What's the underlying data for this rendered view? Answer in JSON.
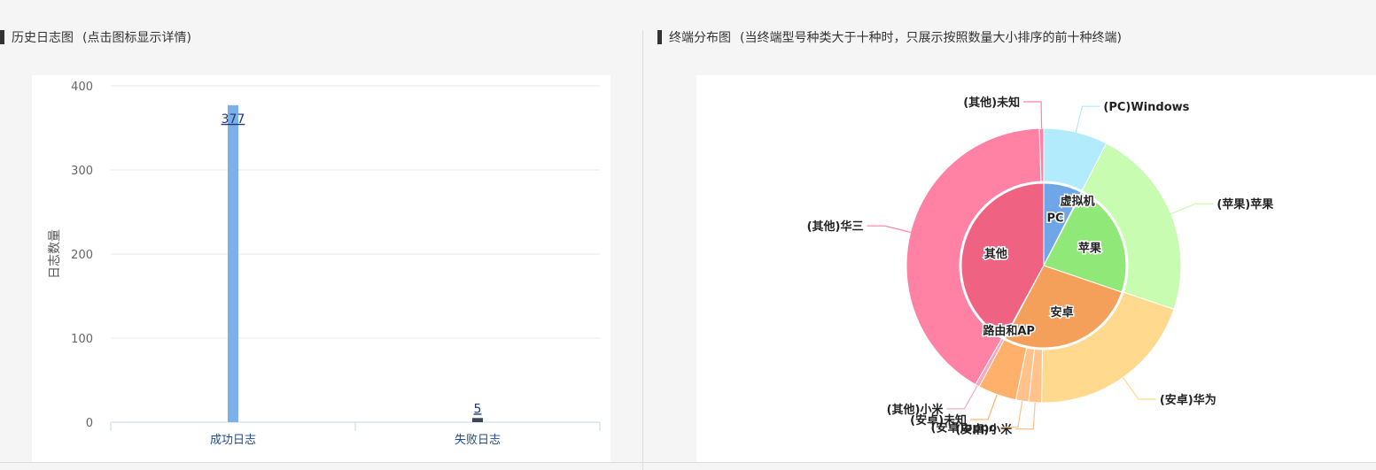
{
  "left_panel": {
    "title": "历史日志图",
    "subtitle": "(点击图标显示详情)"
  },
  "right_panel": {
    "title": "终端分布图",
    "subtitle": "(当终端型号种类大于十种时，只展示按照数量大小排序的前十种终端)"
  },
  "chart_data": [
    {
      "type": "bar",
      "ylabel": "日志数量",
      "categories": [
        "成功日志",
        "失败日志"
      ],
      "values": [
        377,
        5
      ],
      "ylim": [
        0,
        400
      ],
      "yticks": [
        0,
        100,
        200,
        300,
        400
      ],
      "colors": [
        "#7cb0ea",
        "#3d4654"
      ],
      "grid": true
    },
    {
      "type": "pie",
      "inner": {
        "labels": [
          "PC",
          "虚拟机",
          "苹果",
          "安卓",
          "路由和AP",
          "其他"
        ],
        "values": [
          15,
          0.4,
          45,
          55,
          0.4,
          84
        ],
        "colors": [
          "#6ea6e8",
          "#6ea6e8",
          "#90e878",
          "#f5a05a",
          "#f5a05a",
          "#f06282"
        ]
      },
      "outer": {
        "labels": [
          "(PC)Windows",
          "(苹果)苹果",
          "(安卓)华为",
          "(安卓)小米",
          "(安卓)oppo",
          "(安卓)未知",
          "(其他)小米",
          "(其他)华三",
          "(其他)未知"
        ],
        "values": [
          15,
          45,
          40,
          3,
          3,
          9,
          1,
          82,
          1
        ],
        "colors": [
          "#b2ebfb",
          "#c8fcb0",
          "#ffd98e",
          "#ffc28a",
          "#ffc28a",
          "#ffb06a",
          "#f8a7bd",
          "#ff81a3",
          "#ff81a3"
        ]
      }
    }
  ]
}
